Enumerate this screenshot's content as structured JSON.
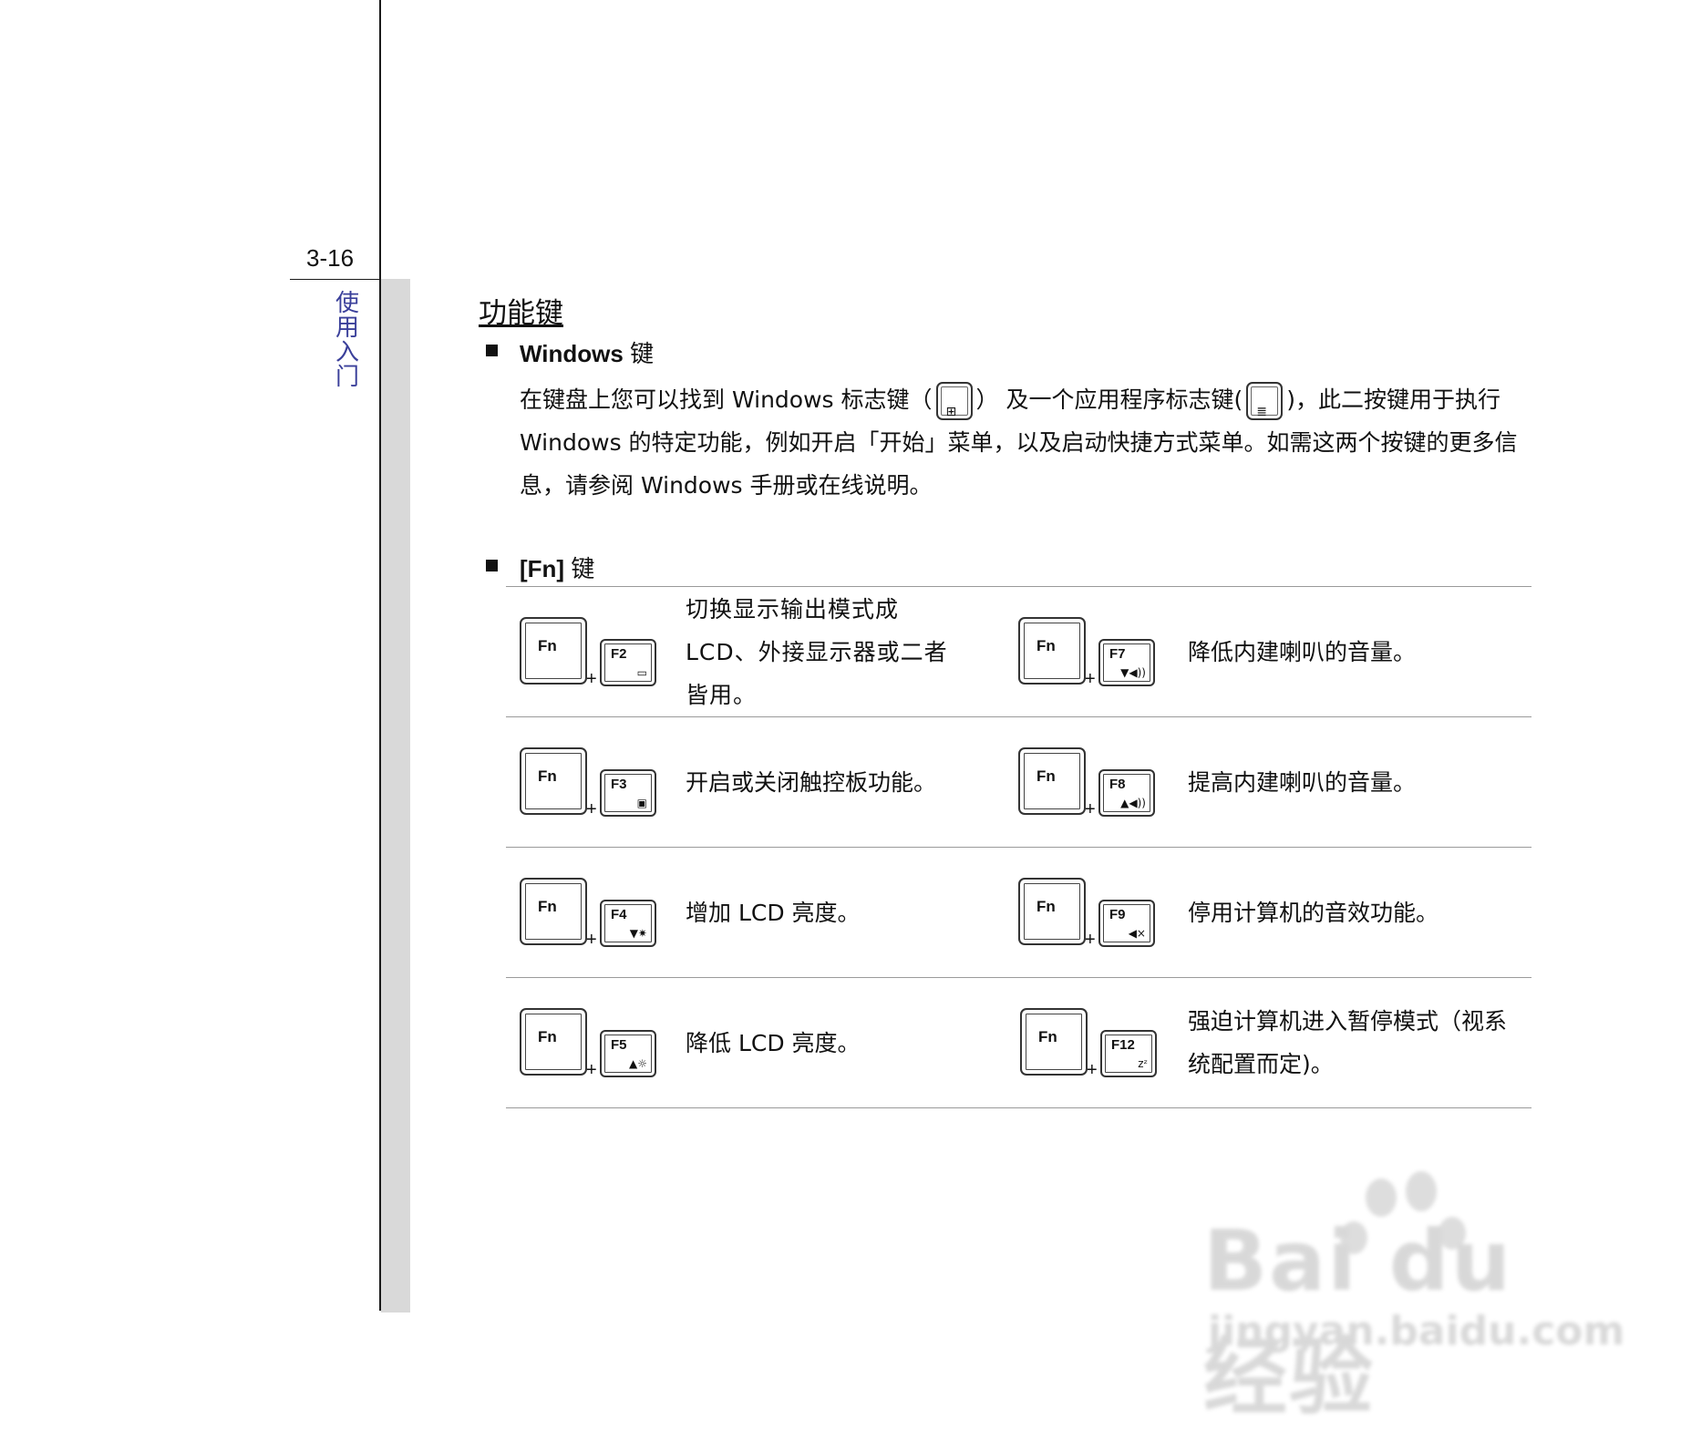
{
  "page": {
    "number": "3-16",
    "chapter_chars": [
      "使",
      "用",
      "入",
      "门"
    ]
  },
  "section": {
    "title": "功能键"
  },
  "windows_key": {
    "heading": "Windows",
    "heading_suffix": "键",
    "text_1": "在键盘上您可以找到 Windows 标志键（",
    "text_2": "） 及一个应用程序标志键(",
    "text_3": ")，此二按键用于执行 Windows 的特定功能，例如开启「开始」菜单，以及启动快捷方式菜单。如需这两个按键的更多信息，请参阅 Windows 手册或在线说明。"
  },
  "fn_key": {
    "heading": "[Fn]",
    "heading_suffix": "键",
    "fn_label": "Fn",
    "rows": [
      {
        "left": {
          "key": "F2",
          "symbol": "▭",
          "desc": "切换显示输出模式成LCD、外接显示器或二者皆用。"
        },
        "right": {
          "key": "F7",
          "symbol": "▼◀))",
          "desc": "降低内建喇叭的音量。"
        }
      },
      {
        "left": {
          "key": "F3",
          "symbol": "▣",
          "desc": "开启或关闭触控板功能。"
        },
        "right": {
          "key": "F8",
          "symbol": "▲◀))",
          "desc": "提高内建喇叭的音量。"
        }
      },
      {
        "left": {
          "key": "F4",
          "symbol": "▼✷",
          "desc": "增加 LCD 亮度。"
        },
        "right": {
          "key": "F9",
          "symbol": "◀×",
          "desc": "停用计算机的音效功能。"
        }
      },
      {
        "left": {
          "key": "F5",
          "symbol": "▲☼",
          "desc": "降低 LCD 亮度。"
        },
        "right": {
          "key": "F12",
          "symbol": "zᶻ",
          "desc": "强迫计算机进入暂停模式（视系统配置而定)。"
        }
      }
    ]
  },
  "watermark": {
    "brand": "Bai du 经验",
    "url": "jingyan.baidu.com"
  }
}
